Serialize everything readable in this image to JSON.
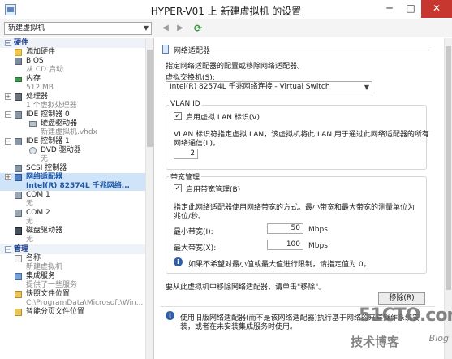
{
  "window": {
    "title": "HYPER-V01 上 新建虚拟机 的设置",
    "minimize": "─",
    "maximize": "□",
    "close": "✕"
  },
  "toolbar": {
    "vm_name": "新建虚拟机",
    "back": "◀",
    "forward": "▶",
    "refresh": "⟳"
  },
  "tree": {
    "hardware_header": "硬件",
    "management_header": "管理",
    "items": {
      "add_hardware": "添加硬件",
      "bios": "BIOS",
      "bios_sub": "从 CD 启动",
      "memory": "内存",
      "memory_sub": "512 MB",
      "processor": "处理器",
      "processor_sub": "1 个虚拟处理器",
      "ide0": "IDE 控制器 0",
      "hdd": "硬盘驱动器",
      "hdd_sub": "新建虚拟机.vhdx",
      "ide1": "IDE 控制器 1",
      "dvd": "DVD 驱动器",
      "dvd_sub": "无",
      "scsi": "SCSI 控制器",
      "nic": "网络适配器",
      "nic_sub": "Intel(R) 82574L 千兆网络...",
      "com1": "COM 1",
      "com1_sub": "无",
      "com2": "COM 2",
      "com2_sub": "无",
      "floppy": "磁盘驱动器",
      "floppy_sub": "无",
      "name": "名称",
      "name_sub": "新建虚拟机",
      "integration": "集成服务",
      "integration_sub": "提供了一些服务",
      "snapshot": "快照文件位置",
      "snapshot_sub": "C:\\ProgramData\\Microsoft\\Win...",
      "smart_paging": "智能分页文件位置"
    }
  },
  "pane": {
    "title": "网络适配器",
    "desc": "指定网络适配器的配置或移除网络适配器。",
    "switch_label": "虚拟交换机(S):",
    "switch_value": "Intel(R) 82574L 千兆网络连接 - Virtual Switch",
    "vlan": {
      "title": "VLAN ID",
      "enable_label": "启用虚拟 LAN 标识(V)",
      "desc1": "VLAN 标识符指定虚拟 LAN，该虚拟机将此 LAN 用于通过此网络适配器的所有",
      "desc2": "网络通信(L)。",
      "value": "2"
    },
    "bandwidth": {
      "title": "带宽管理",
      "enable_label": "启用带宽管理(B)",
      "desc1": "指定此网络适配器使用网络带宽的方式。最小带宽和最大带宽的测量单位为",
      "desc2": "兆位/秒。",
      "min_label": "最小带宽(I):",
      "min_value": "50",
      "max_label": "最大带宽(X):",
      "max_value": "100",
      "unit": "Mbps",
      "info": "如果不希望对最小值或最大值进行限制，请指定值为 0。"
    },
    "remove_desc": "要从此虚拟机中移除网络适配器，请单击\"移除\"。",
    "remove_button": "移除(R)",
    "bottom_info1": "使用旧版网络适配器(而不是该网络适配器)执行基于网络的来宾操作系统安",
    "bottom_info2": "装，或者在未安装集成服务时使用。"
  },
  "watermark": {
    "brand": "51CTO.com",
    "subtitle": "技术博客",
    "blog": "Blog"
  }
}
